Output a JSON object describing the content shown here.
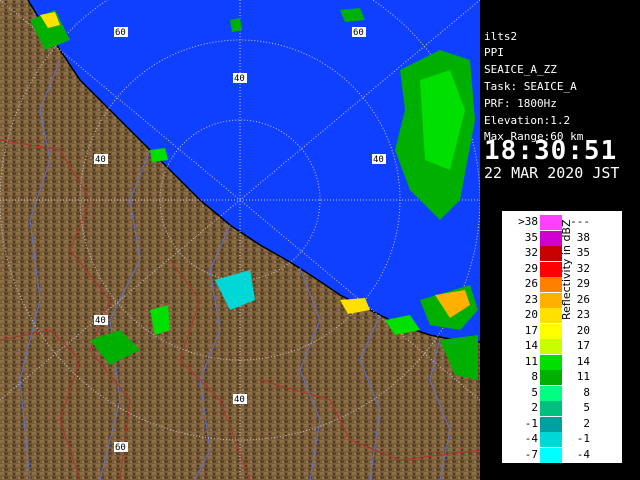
{
  "radar": {
    "station": "ilts2",
    "product": "PPI",
    "field": "SEAICE_A_ZZ",
    "task": "Task: SEAICE_A",
    "prf": "PRF: 1800Hz",
    "elevation": "Elevation:1.2",
    "max_range": "Max Range:60 km",
    "time": "18:30:51",
    "date": "22 MAR 2020 JST"
  },
  "range_rings": {
    "labels_km": [
      "40",
      "60"
    ],
    "ring_label_instances": [
      "60",
      "60",
      "40",
      "40",
      "40",
      "40",
      "40",
      "60"
    ]
  },
  "legend": {
    "title": "Reflectivity in dBZ",
    "rows": [
      {
        "lo": ">38",
        "hi": "---",
        "color": "#ff40ff"
      },
      {
        "lo": "35",
        "hi": "38",
        "color": "#d000d0"
      },
      {
        "lo": "32",
        "hi": "35",
        "color": "#c80000"
      },
      {
        "lo": "29",
        "hi": "32",
        "color": "#ff0000"
      },
      {
        "lo": "26",
        "hi": "29",
        "color": "#ff8000"
      },
      {
        "lo": "23",
        "hi": "26",
        "color": "#ffb000"
      },
      {
        "lo": "20",
        "hi": "23",
        "color": "#ffe000"
      },
      {
        "lo": "17",
        "hi": "20",
        "color": "#ffff00"
      },
      {
        "lo": "14",
        "hi": "17",
        "color": "#c8ff00"
      },
      {
        "lo": "11",
        "hi": "14",
        "color": "#00e000"
      },
      {
        "lo": "8",
        "hi": "11",
        "color": "#00b000"
      },
      {
        "lo": "5",
        "hi": "8",
        "color": "#00ff80"
      },
      {
        "lo": "2",
        "hi": "5",
        "color": "#00c080"
      },
      {
        "lo": "-1",
        "hi": "2",
        "color": "#00a0a0"
      },
      {
        "lo": "-4",
        "hi": "-1",
        "color": "#00d8d8"
      },
      {
        "lo": "-7",
        "hi": "-4",
        "color": "#00ffff"
      }
    ]
  },
  "colors": {
    "sea": "#1040ff",
    "land": "#7a5e3a",
    "land_dark": "#4a3520",
    "range_ring": "#c8c8c8",
    "coast": "#000000",
    "rivers": "#6070d0",
    "boundaries": "#b03030"
  }
}
